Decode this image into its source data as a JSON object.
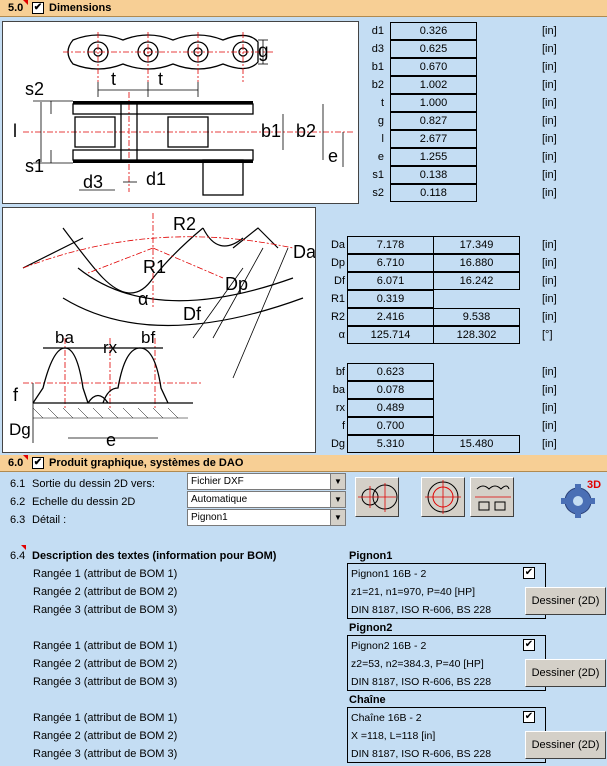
{
  "section5": {
    "num": "5.0",
    "check": "✔",
    "title": "Dimensions"
  },
  "drawing1": {
    "labels": [
      "g",
      "s2",
      "t",
      "t",
      "l",
      "b1",
      "b2",
      "e",
      "s1",
      "d3",
      "d1"
    ]
  },
  "dims": [
    {
      "label": "d1",
      "value": "0.326",
      "unit": "[in]"
    },
    {
      "label": "d3",
      "value": "0.625",
      "unit": "[in]"
    },
    {
      "label": "b1",
      "value": "0.670",
      "unit": "[in]"
    },
    {
      "label": "b2",
      "value": "1.002",
      "unit": "[in]"
    },
    {
      "label": "t",
      "value": "1.000",
      "unit": "[in]"
    },
    {
      "label": "g",
      "value": "0.827",
      "unit": "[in]"
    },
    {
      "label": "l",
      "value": "2.677",
      "unit": "[in]"
    },
    {
      "label": "e",
      "value": "1.255",
      "unit": "[in]"
    },
    {
      "label": "s1",
      "value": "0.138",
      "unit": "[in]"
    },
    {
      "label": "s2",
      "value": "0.118",
      "unit": "[in]"
    }
  ],
  "drawing2": {
    "labels": [
      "R2",
      "Da",
      "R1",
      "Dp",
      "α",
      "Df",
      "ba",
      "rx",
      "bf",
      "f",
      "Dg",
      "e"
    ]
  },
  "sprocketDims": [
    {
      "label": "Da",
      "v1": "7.178",
      "v2": "17.349",
      "unit": "[in]"
    },
    {
      "label": "Dp",
      "v1": "6.710",
      "v2": "16.880",
      "unit": "[in]"
    },
    {
      "label": "Df",
      "v1": "6.071",
      "v2": "16.242",
      "unit": "[in]"
    },
    {
      "label": "R1",
      "v1": "0.319",
      "v2": "",
      "unit": "[in]"
    },
    {
      "label": "R2",
      "v1": "2.416",
      "v2": "9.538",
      "unit": "[in]"
    },
    {
      "label": "α",
      "v1": "125.714",
      "v2": "128.302",
      "unit": "[°]"
    }
  ],
  "toothDims": [
    {
      "label": "bf",
      "v1": "0.623",
      "v2": "",
      "unit": "[in]"
    },
    {
      "label": "ba",
      "v1": "0.078",
      "v2": "",
      "unit": "[in]"
    },
    {
      "label": "rx",
      "v1": "0.489",
      "v2": "",
      "unit": "[in]"
    },
    {
      "label": "f",
      "v1": "0.700",
      "v2": "",
      "unit": "[in]"
    },
    {
      "label": "Dg",
      "v1": "5.310",
      "v2": "15.480",
      "unit": "[in]"
    }
  ],
  "section6": {
    "num": "6.0",
    "check": "✔",
    "title": "Produit graphique, systèmes de DAO",
    "rows": [
      {
        "num": "6.1",
        "label": "Sortie du dessin 2D vers:",
        "value": "Fichier DXF"
      },
      {
        "num": "6.2",
        "label": "Echelle du dessin 2D",
        "value": "Automatique"
      },
      {
        "num": "6.3",
        "label": "Détail :",
        "value": "Pignon1"
      }
    ],
    "badge3d": "3D"
  },
  "bom": {
    "num": "6.4",
    "title": "Description des textes (information pour BOM)",
    "groups": [
      {
        "name": "Pignon1",
        "rows": [
          "Rangée 1 (attribut de BOM 1)",
          "Rangée 2 (attribut de BOM 2)",
          "Rangée 3 (attribut de BOM 3)"
        ],
        "texts": [
          "Pignon1  16B - 2",
          "z1=21,  n1=970, P=40 [HP]",
          "DIN 8187, ISO R-606, BS 228"
        ],
        "check": "✔",
        "button": "Dessiner (2D)"
      },
      {
        "name": "Pignon2",
        "rows": [
          "Rangée 1 (attribut de BOM 1)",
          "Rangée 2 (attribut de BOM 2)",
          "Rangée 3 (attribut de BOM 3)"
        ],
        "texts": [
          "Pignon2  16B - 2",
          "z2=53,  n2=384.3, P=40 [HP]",
          "DIN 8187, ISO R-606, BS 228"
        ],
        "check": "✔",
        "button": "Dessiner (2D)"
      },
      {
        "name": "Chaîne",
        "rows": [
          "Rangée 1 (attribut de BOM 1)",
          "Rangée 2 (attribut de BOM 2)",
          "Rangée 3 (attribut de BOM 3)"
        ],
        "texts": [
          "Chaîne  16B - 2",
          "X =118, L=118 [in]",
          "DIN 8187, ISO R-606, BS 228"
        ],
        "check": "✔",
        "button": "Dessiner (2D)"
      }
    ]
  }
}
